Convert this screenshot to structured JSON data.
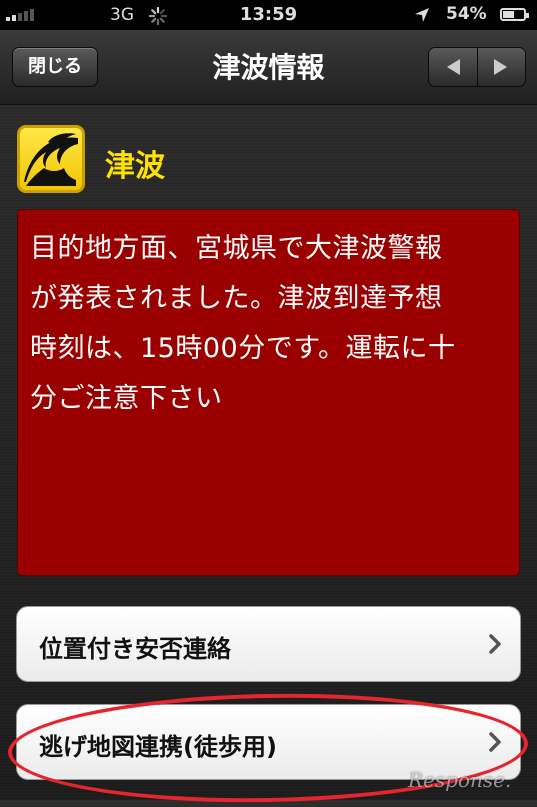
{
  "status_bar": {
    "carrier": "3G",
    "time": "13:59",
    "battery_percent": "54%",
    "battery_level": 0.54,
    "icons": [
      "signal-icon",
      "spinner-icon",
      "location-arrow-icon",
      "battery-icon"
    ]
  },
  "navbar": {
    "close_label": "閉じる",
    "title": "津波情報",
    "prev_icon": "triangle-left-icon",
    "next_icon": "triangle-right-icon"
  },
  "header": {
    "icon": "tsunami-wave-icon",
    "title": "津波"
  },
  "message": {
    "lines": [
      "目的地方面、宮城県で大津波警報",
      "が発表されました。津波到達予想",
      "時刻は、15時00分です。運転に十",
      "分ご注意下さい"
    ]
  },
  "actions": [
    {
      "label": "位置付き安否連絡",
      "icon": "chevron-right-icon"
    },
    {
      "label": "逃げ地図連携(徒歩用)",
      "icon": "chevron-right-icon"
    }
  ],
  "watermark": "Response.",
  "colors": {
    "message_bg": "#9b0000",
    "title_yellow": "#ffe200",
    "annotation_red": "#e6262f"
  }
}
